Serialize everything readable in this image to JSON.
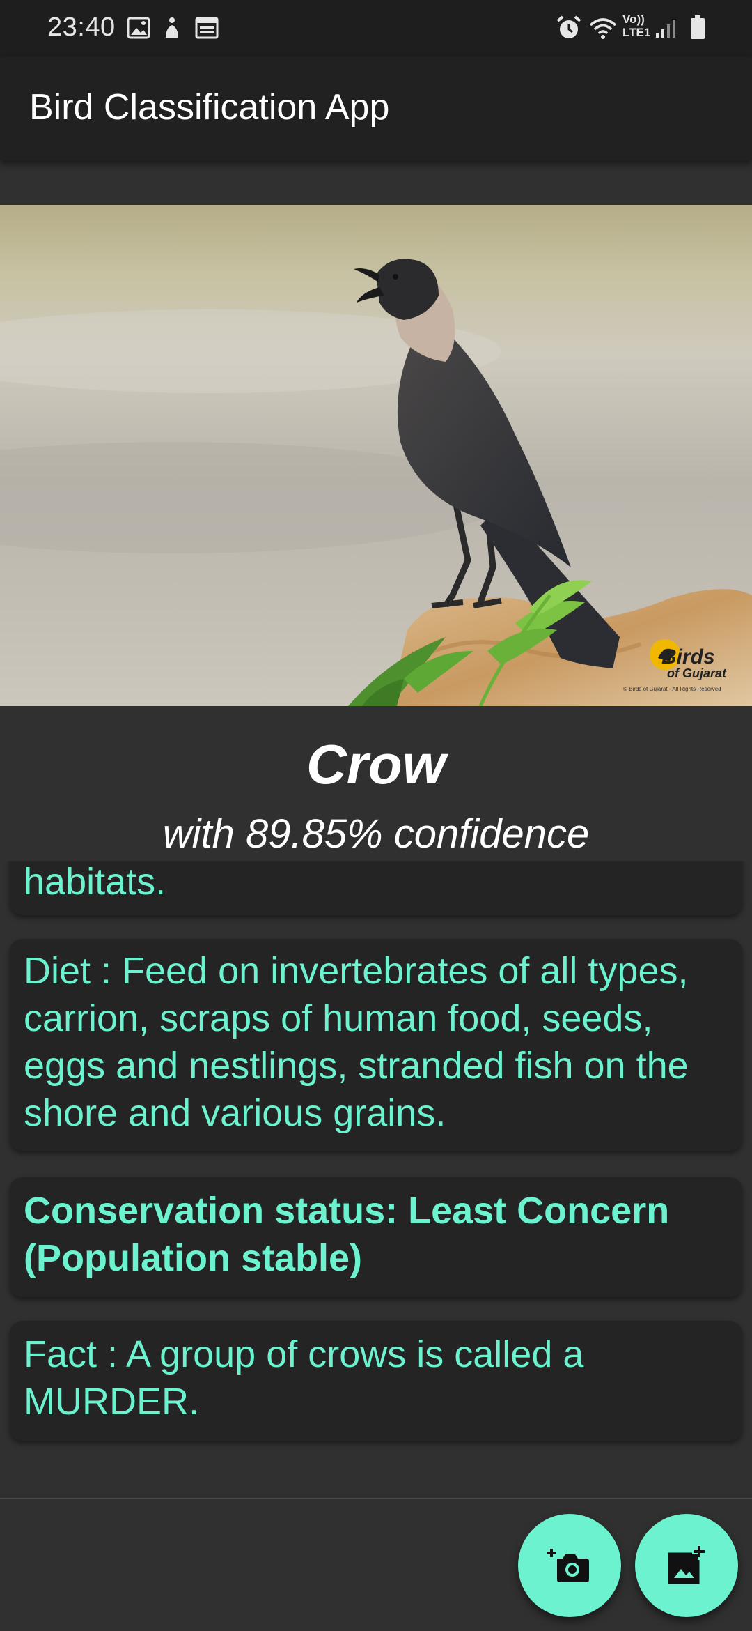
{
  "status_bar": {
    "time": "23:40",
    "network_label": "Vo)) LTE1",
    "icons": [
      "image-icon",
      "accessibility-icon",
      "calendar-icon",
      "alarm-icon",
      "wifi-icon",
      "signal-icon",
      "battery-icon"
    ]
  },
  "app_bar": {
    "title": "Bird Classification App"
  },
  "photo": {
    "watermark_line1": "Birds",
    "watermark_line2": "of Gujarat",
    "watermark_copyright": "© Birds of Gujarat - All Rights Reserved"
  },
  "result": {
    "species": "Crow",
    "confidence": "with 89.85% confidence"
  },
  "cards": [
    {
      "text": "habitats."
    },
    {
      "text": "Diet : Feed on invertebrates of all types, carrion, scraps of human food, seeds, eggs and nestlings, stranded fish on the shore and various grains."
    },
    {
      "text": "Conservation status: Least Concern (Population stable)"
    },
    {
      "text": "Fact : A group of crows is called a MURDER."
    }
  ],
  "fabs": {
    "camera": {
      "icon": "add-photo-camera-icon"
    },
    "gallery": {
      "icon": "add-photo-gallery-icon"
    }
  },
  "colors": {
    "accent": "#6cf2cf",
    "background": "#303030",
    "app_bar": "#212121",
    "card": "#242424",
    "status_bar": "#1e1e1e"
  }
}
